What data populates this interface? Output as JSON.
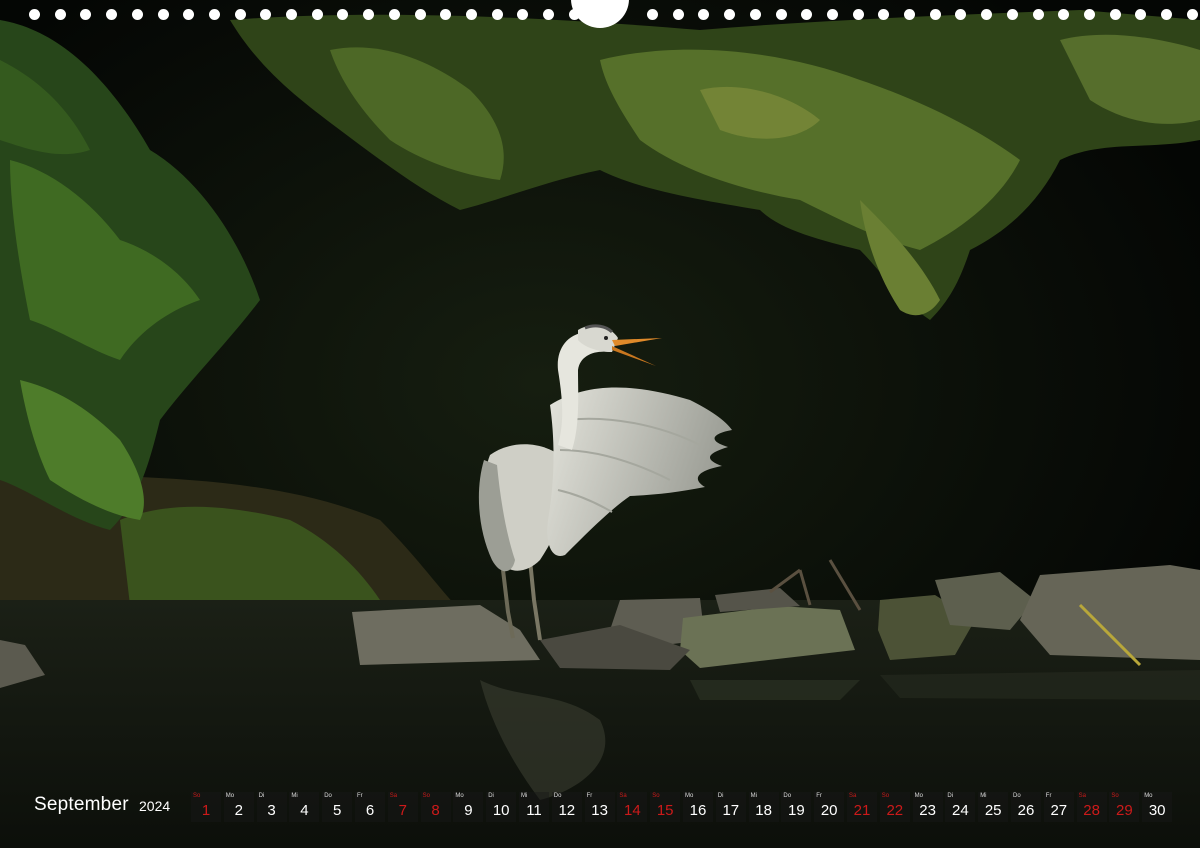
{
  "photo": {
    "subject": "grey-heron",
    "colors": {
      "foliage": "#3f5a1f",
      "water": "#1a1e14",
      "rock": "#6b6a5c",
      "heron": "#d8d8d0",
      "beak": "#e08a2a"
    }
  },
  "calendar": {
    "month": "September",
    "year": "2024",
    "weekend_color": "#cc1a1a",
    "days": [
      {
        "wd": "So",
        "num": "1",
        "weekend": true
      },
      {
        "wd": "Mo",
        "num": "2",
        "weekend": false
      },
      {
        "wd": "Di",
        "num": "3",
        "weekend": false
      },
      {
        "wd": "Mi",
        "num": "4",
        "weekend": false
      },
      {
        "wd": "Do",
        "num": "5",
        "weekend": false
      },
      {
        "wd": "Fr",
        "num": "6",
        "weekend": false
      },
      {
        "wd": "Sa",
        "num": "7",
        "weekend": true
      },
      {
        "wd": "So",
        "num": "8",
        "weekend": true
      },
      {
        "wd": "Mo",
        "num": "9",
        "weekend": false
      },
      {
        "wd": "Di",
        "num": "10",
        "weekend": false
      },
      {
        "wd": "Mi",
        "num": "11",
        "weekend": false
      },
      {
        "wd": "Do",
        "num": "12",
        "weekend": false
      },
      {
        "wd": "Fr",
        "num": "13",
        "weekend": false
      },
      {
        "wd": "Sa",
        "num": "14",
        "weekend": true
      },
      {
        "wd": "So",
        "num": "15",
        "weekend": true
      },
      {
        "wd": "Mo",
        "num": "16",
        "weekend": false
      },
      {
        "wd": "Di",
        "num": "17",
        "weekend": false
      },
      {
        "wd": "Mi",
        "num": "18",
        "weekend": false
      },
      {
        "wd": "Do",
        "num": "19",
        "weekend": false
      },
      {
        "wd": "Fr",
        "num": "20",
        "weekend": false
      },
      {
        "wd": "Sa",
        "num": "21",
        "weekend": true
      },
      {
        "wd": "So",
        "num": "22",
        "weekend": true
      },
      {
        "wd": "Mo",
        "num": "23",
        "weekend": false
      },
      {
        "wd": "Di",
        "num": "24",
        "weekend": false
      },
      {
        "wd": "Mi",
        "num": "25",
        "weekend": false
      },
      {
        "wd": "Do",
        "num": "26",
        "weekend": false
      },
      {
        "wd": "Fr",
        "num": "27",
        "weekend": false
      },
      {
        "wd": "Sa",
        "num": "28",
        "weekend": true
      },
      {
        "wd": "So",
        "num": "29",
        "weekend": true
      },
      {
        "wd": "Mo",
        "num": "30",
        "weekend": false
      }
    ]
  }
}
